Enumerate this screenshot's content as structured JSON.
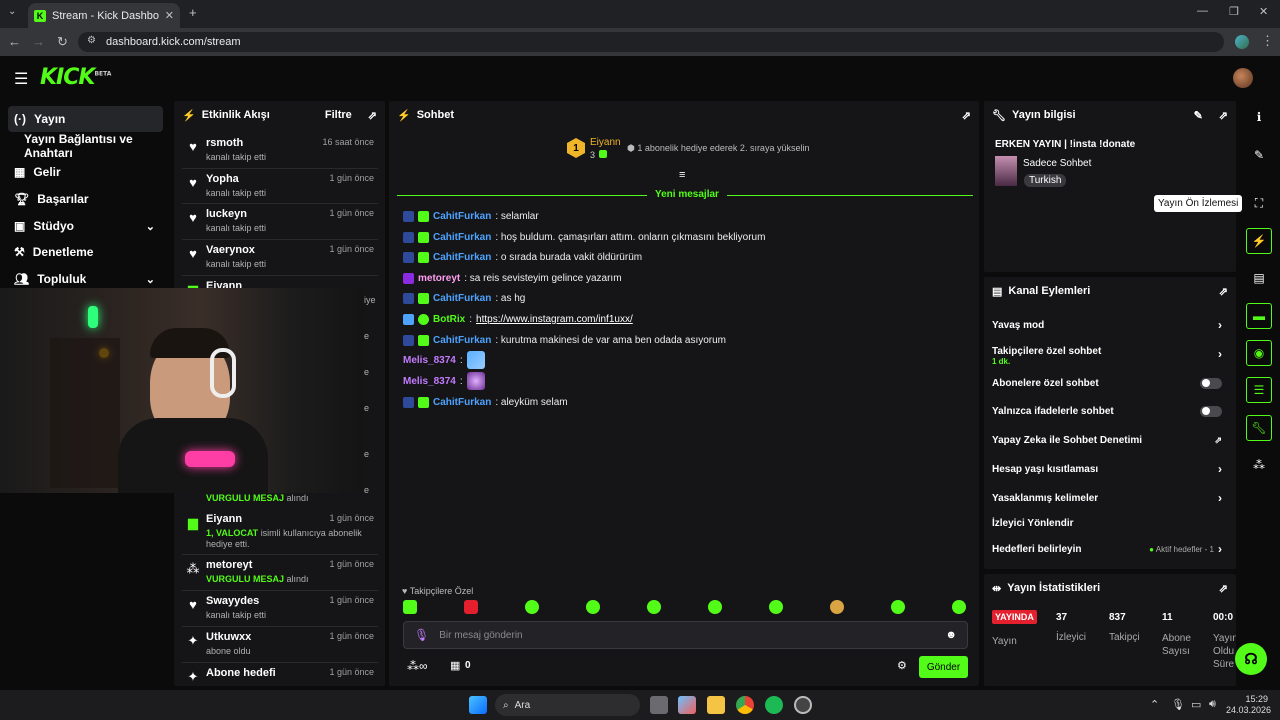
{
  "browser": {
    "tab_title": "Stream - Kick Dashboard",
    "new_tab": "+",
    "url": "dashboard.kick.com/stream"
  },
  "header": {
    "logo": "KICK",
    "logo_badge": "BETA"
  },
  "nav": {
    "items": [
      {
        "label": "Yayın",
        "icon": "broadcast-icon"
      },
      {
        "label": "Yayın Bağlantısı ve Anahtarı"
      },
      {
        "label": "Gelir",
        "icon": "chart-icon"
      },
      {
        "label": "Başarılar",
        "icon": "trophy-icon"
      },
      {
        "label": "Stüdyo",
        "icon": "studio-icon"
      },
      {
        "label": "Denetleme",
        "icon": "shield-icon"
      },
      {
        "label": "Topluluk",
        "icon": "community-icon"
      }
    ]
  },
  "activity": {
    "title": "Etkinlik Akışı",
    "filter": "Filtre",
    "items": [
      {
        "name": "rsmoth",
        "time": "16 saat önce",
        "sub": "kanalı takip etti"
      },
      {
        "name": "Yopha",
        "time": "1 gün önce",
        "sub": "kanalı takip etti"
      },
      {
        "name": "luckeyn",
        "time": "1 gün önce",
        "sub": "kanalı takip etti"
      },
      {
        "name": "Vaerynox",
        "time": "1 gün önce",
        "sub": "kanalı takip etti"
      },
      {
        "name": "Eiyann",
        "time": "",
        "sub": ""
      }
    ],
    "items_bottom": [
      {
        "name": "Eiyann",
        "time": "1 gün önce",
        "sub_green": "1, VALOCAT",
        "sub": "isimli kullanıcıya abonelik hediye etti."
      },
      {
        "name": "metoreyt",
        "time": "1 gün önce",
        "sub_green": "VURGULU MESAJ",
        "sub": "alındı"
      },
      {
        "name": "Swayydes",
        "time": "1 gün önce",
        "sub": "kanalı takip etti"
      },
      {
        "name": "Utkuwxx",
        "time": "1 gün önce",
        "sub": "abone oldu"
      },
      {
        "name": "Abone hedefi",
        "time": "1 gün önce",
        "sub": ""
      }
    ],
    "partial_top_sub": "iye",
    "partial_green": "VURGULU MESAJ",
    "partial_sub": "alındı"
  },
  "chat": {
    "title": "Sohbet",
    "pinned_user": "Eiyann",
    "pinned_count": "3",
    "pinned_info": "1 abonelik hediye ederek 2. sıraya yükselin",
    "new_messages": "Yeni mesajlar",
    "messages": [
      {
        "user": "CahitFurkan",
        "text": ": selamlar"
      },
      {
        "user": "CahitFurkan",
        "text": ": hoş buldum. çamaşırları attım. onların çıkmasını bekliyorum"
      },
      {
        "user": "CahitFurkan",
        "text": ": o sırada burada vakit öldürürüm"
      },
      {
        "user": "metoreyt",
        "text": ": sa reis sevisteyim gelince yazarım"
      },
      {
        "user": "CahitFurkan",
        "text": ": as hg"
      },
      {
        "user": "BotRix",
        "text": ": ",
        "link": "https://www.instagram.com/inf1uxx/"
      },
      {
        "user": "CahitFurkan",
        "text": ": kurutma makinesi de var ama ben odada asıyorum"
      },
      {
        "user": "Melis_8374",
        "text": ":"
      },
      {
        "user": "Melis_8374",
        "text": ":"
      },
      {
        "user": "CahitFurkan",
        "text": ": aleyküm selam"
      }
    ],
    "followers_only": "Takipçilere Özel",
    "input_placeholder": "Bir mesaj gönderin",
    "points": "0",
    "send": "Gönder"
  },
  "stream_info": {
    "title": "Yayın bilgisi",
    "stream_title": "ERKEN YAYIN | !insta !donate",
    "category": "Sadece Sohbet",
    "language": "Turkish"
  },
  "tooltip": "Yayın Ön İzlemesi",
  "channel_actions": {
    "title": "Kanal Eylemleri",
    "items": [
      {
        "label": "Yavaş mod",
        "kind": "arrow"
      },
      {
        "label": "Takipçilere özel sohbet",
        "sub": "1 dk.",
        "kind": "arrow"
      },
      {
        "label": "Abonelere özel sohbet",
        "kind": "toggle"
      },
      {
        "label": "Yalnızca ifadelerle sohbet",
        "kind": "toggle"
      },
      {
        "label": "Yapay Zeka ile Sohbet Denetimi",
        "kind": "external"
      },
      {
        "label": "Hesap yaşı kısıtlaması",
        "kind": "arrow"
      },
      {
        "label": "Yasaklanmış kelimeler",
        "kind": "arrow"
      },
      {
        "label": "İzleyici Yönlendir",
        "kind": "none"
      },
      {
        "label": "Hedefleri belirleyin",
        "kind": "arrow",
        "extra": "Aktif hedefler - 1"
      }
    ]
  },
  "stats": {
    "title": "Yayın İstatistikleri",
    "live_badge": "YAYINDA",
    "live_label": "Yayın",
    "items": [
      {
        "value": "37",
        "label": "İzleyici"
      },
      {
        "value": "837",
        "label": "Takipçi"
      },
      {
        "value": "11",
        "label": "Abone Sayısı"
      },
      {
        "value": "00:0",
        "label": "Yayın Oldu Süre"
      }
    ]
  },
  "taskbar": {
    "search": "Ara",
    "time": "15:29",
    "date": "24.03.2026"
  },
  "colors": {
    "accent": "#53fc18",
    "panel": "#151517",
    "bg": "#0b0b0c",
    "live": "#e5202e"
  }
}
